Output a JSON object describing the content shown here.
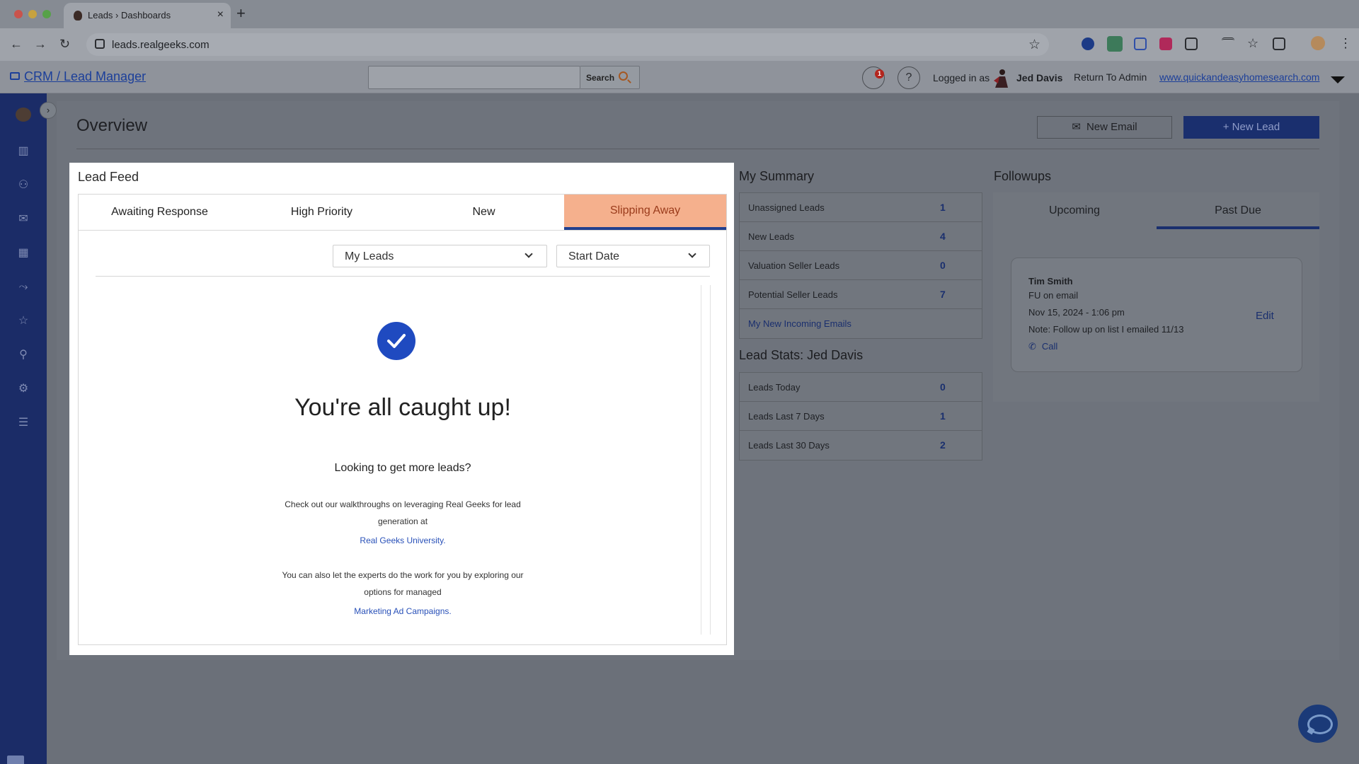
{
  "browser": {
    "tab_title": "Leads › Dashboards",
    "tab_close": "×",
    "new_tab": "+",
    "url": "leads.realgeeks.com"
  },
  "header": {
    "crm_link": "CRM / Lead Manager",
    "search_placeholder": "",
    "search_label": "Search",
    "notification_count": "1",
    "help_glyph": "?",
    "logged_in_label": "Logged in as",
    "user_name": "Jed Davis",
    "return_admin": "Return To Admin",
    "site_link": "www.quickandeasyhomesearch.com"
  },
  "sidebar": {
    "items": [
      {
        "icon": "bar-chart-icon",
        "glyph": "▥"
      },
      {
        "icon": "users-icon",
        "glyph": "⚇"
      },
      {
        "icon": "mail-icon",
        "glyph": "✉"
      },
      {
        "icon": "calendar-icon",
        "glyph": "▦"
      },
      {
        "icon": "routing-icon",
        "glyph": "⤳"
      },
      {
        "icon": "star-icon",
        "glyph": "☆"
      },
      {
        "icon": "user-settings-icon",
        "glyph": "⚲"
      },
      {
        "icon": "gear-icon",
        "glyph": "⚙"
      },
      {
        "icon": "checklist-icon",
        "glyph": "☰"
      }
    ],
    "toggle_glyph": "›"
  },
  "main": {
    "title": "Overview",
    "new_email": "New Email",
    "new_lead": "+ New Lead"
  },
  "lead_feed": {
    "title": "Lead Feed",
    "tabs": [
      "Awaiting Response",
      "High Priority",
      "New",
      "Slipping Away"
    ],
    "active_tab": "Slipping Away",
    "filter_owner": "My Leads",
    "filter_date": "Start Date",
    "empty_title": "You're all caught up!",
    "empty_subtitle": "Looking to get more leads?",
    "para1_line1": "Check out our walkthroughs on leveraging Real Geeks for lead",
    "para1_line2": "generation at",
    "link1": "Real Geeks University.",
    "para2_line1": "You can also let the experts do the work for you by exploring our",
    "para2_line2": "options for managed",
    "link2": "Marketing Ad Campaigns."
  },
  "summary": {
    "title": "My Summary",
    "rows": [
      {
        "label": "Unassigned Leads",
        "count": "1"
      },
      {
        "label": "New Leads",
        "count": "4"
      },
      {
        "label": "Valuation Seller Leads",
        "count": "0"
      },
      {
        "label": "Potential Seller Leads",
        "count": "7"
      }
    ],
    "link": "My New Incoming Emails"
  },
  "lead_stats": {
    "title": "Lead Stats: Jed Davis",
    "rows": [
      {
        "label": "Leads Today",
        "count": "0"
      },
      {
        "label": "Leads Last 7 Days",
        "count": "1"
      },
      {
        "label": "Leads Last 30 Days",
        "count": "2"
      }
    ]
  },
  "followups": {
    "title": "Followups",
    "tabs": [
      "Upcoming",
      "Past Due"
    ],
    "active_tab": "Past Due",
    "card": {
      "name": "Tim Smith",
      "type": "FU on email",
      "datetime": "Nov 15, 2024 - 1:06 pm",
      "note": "Note: Follow up on list I emailed 11/13",
      "call": "Call",
      "edit": "Edit"
    }
  },
  "colors": {
    "brand": "#1a2f6e",
    "active_tab_bg": "#f5b08d",
    "check": "#1f4ac0"
  }
}
